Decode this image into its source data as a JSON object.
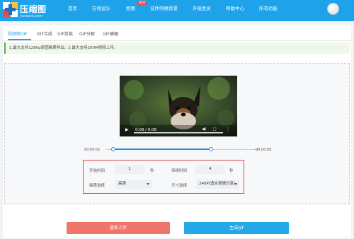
{
  "header": {
    "logo_title": "压缩图",
    "logo_sub": "yasuotu.com",
    "nav": [
      "首页",
      "在线设计",
      "抠图",
      "证件照换背景",
      "升级会员",
      "帮助中心",
      "所有功能"
    ],
    "new_badge": "NEW"
  },
  "tabs": [
    "视频转GIF",
    "GIF合成",
    "GIF剪裁",
    "GIF分解",
    "GIF横幅"
  ],
  "active_tab": "视频转GIF",
  "notice": "1.最大支持1280p原图画质导出。2.最大支持200M视频上传。",
  "video": {
    "time_display": "0:08 / 0:08",
    "icons": [
      "play-icon",
      "volume-icon",
      "fullscreen-icon",
      "more-icon"
    ]
  },
  "range": {
    "start_label": "00:00:01",
    "end_label": "00:00:08",
    "selection_start_fraction": 0.05,
    "selection_end_fraction": 0.69
  },
  "settings": {
    "start_time_label": "开始时间",
    "start_time_value": "1",
    "start_time_unit": "秒",
    "duration_label": "持续时间",
    "duration_value": "4",
    "duration_unit": "秒",
    "quality_label": "画质选择",
    "quality_value": "高清",
    "size_label": "尺寸选择",
    "size_value": "240P(适合表情分享)"
  },
  "buttons": {
    "reupload": "重新上传",
    "generate": "生成gif"
  },
  "colors": {
    "header": "#1ea3ea",
    "reupload": "#f0766a",
    "generate": "#23a8ea",
    "highlight_box": "#e04848"
  }
}
